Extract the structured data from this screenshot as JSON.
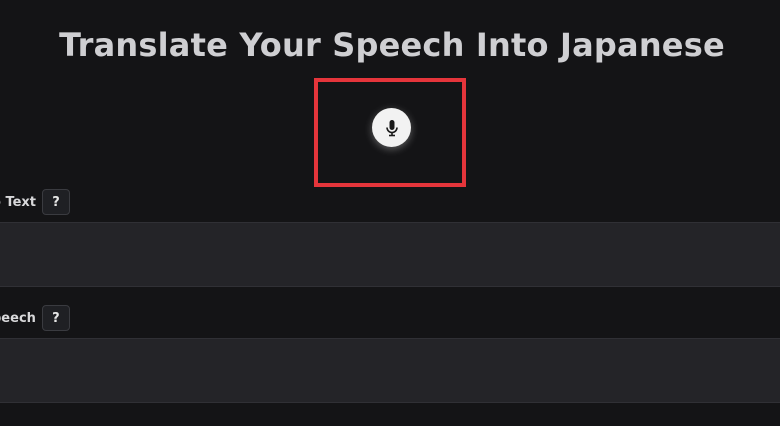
{
  "header": {
    "title": "Translate Your Speech Into Japanese"
  },
  "mic": {
    "icon": "microphone-icon",
    "highlight_color": "#e5353b"
  },
  "sections": [
    {
      "label": "o Text",
      "help_label": "?",
      "content": ""
    },
    {
      "label": "peech",
      "help_label": "?",
      "content": ""
    }
  ],
  "colors": {
    "background": "#141416",
    "panel": "#242428",
    "title": "#cfcfd2"
  }
}
